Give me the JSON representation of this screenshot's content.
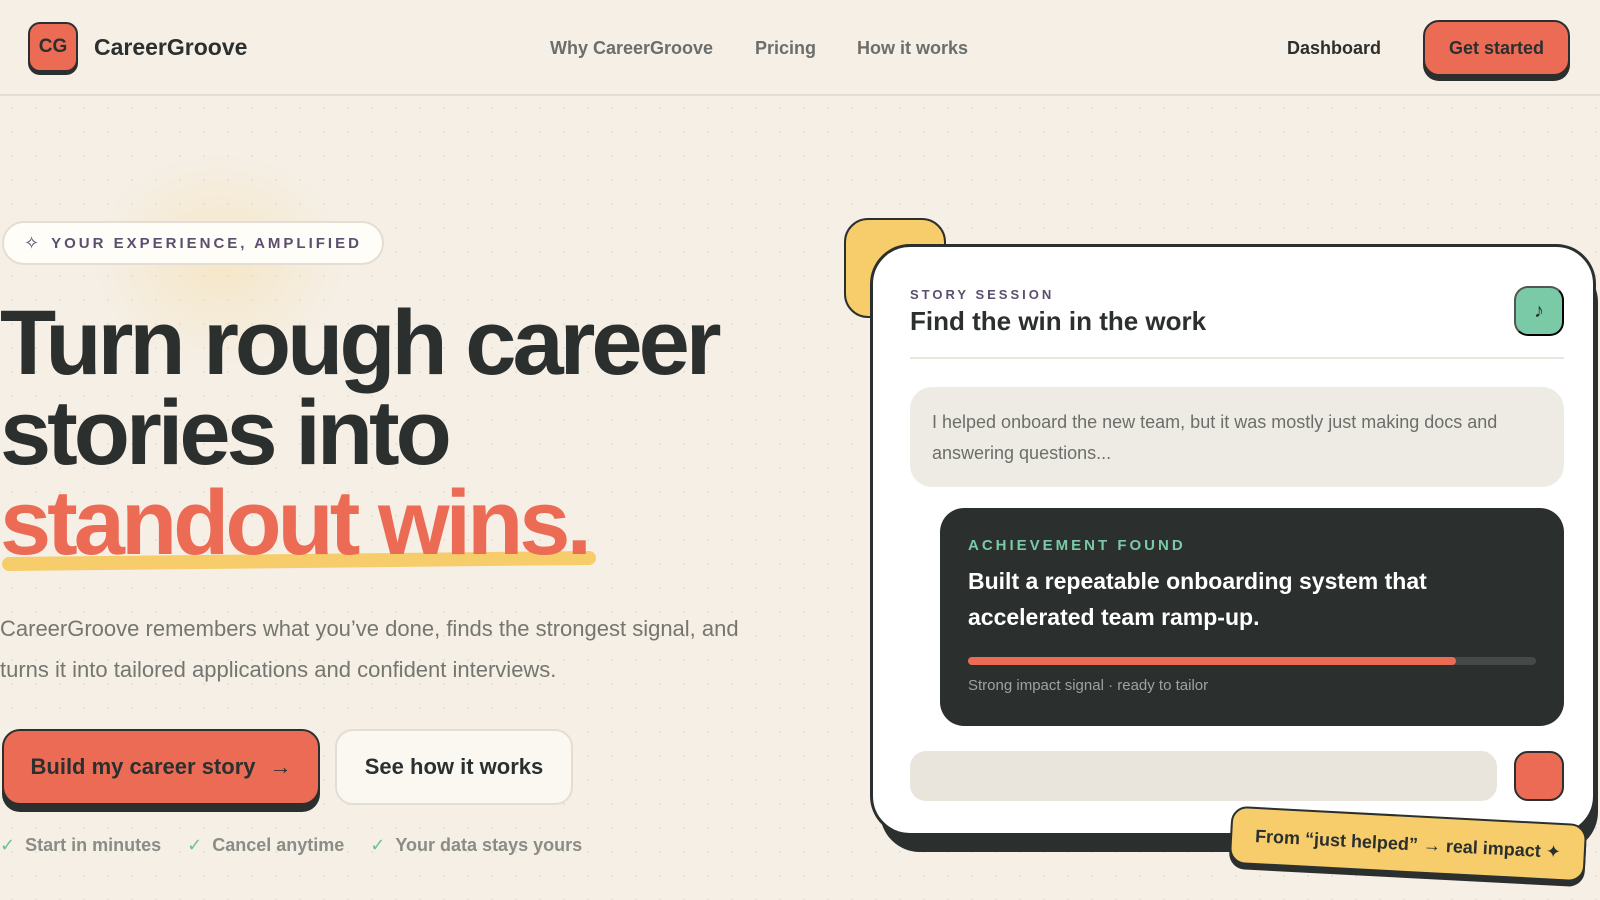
{
  "header": {
    "logo_initials": "CG",
    "brand": "CareerGroove",
    "nav": [
      "Why CareerGroove",
      "Pricing",
      "How it works"
    ],
    "dashboard": "Dashboard",
    "cta": "Get started"
  },
  "hero": {
    "eyebrow": "YOUR EXPERIENCE, AMPLIFIED",
    "headline_line1": "Turn rough career",
    "headline_line2": "stories into",
    "headline_accent": "standout wins.",
    "subtitle": "CareerGroove remembers what you’ve done, finds the strongest signal, and turns it into tailored applications and confident interviews.",
    "primary_button": "Build my career story",
    "primary_arrow": "→",
    "secondary_button": "See how it works",
    "checks": [
      "Start in minutes",
      "Cancel anytime",
      "Your data stays yours"
    ]
  },
  "card": {
    "label": "STORY SESSION",
    "title": "Find the win in the work",
    "music_icon": "♪",
    "user_message": "I helped onboard the new team, but it was mostly just making docs and answering questions...",
    "achievement_label": "ACHIEVEMENT FOUND",
    "achievement_text": "Built a repeatable onboarding system that accelerated team ramp-up.",
    "signal_strength": 0.86,
    "caption": "Strong impact signal · ready to tailor",
    "sticker": "From “just helped” → real impact ✦"
  },
  "colors": {
    "background": "#f5efe6",
    "accent": "#ec6b55",
    "dark": "#2b302f",
    "yellow": "#f6cd6a",
    "mint": "#7ac9a7"
  }
}
